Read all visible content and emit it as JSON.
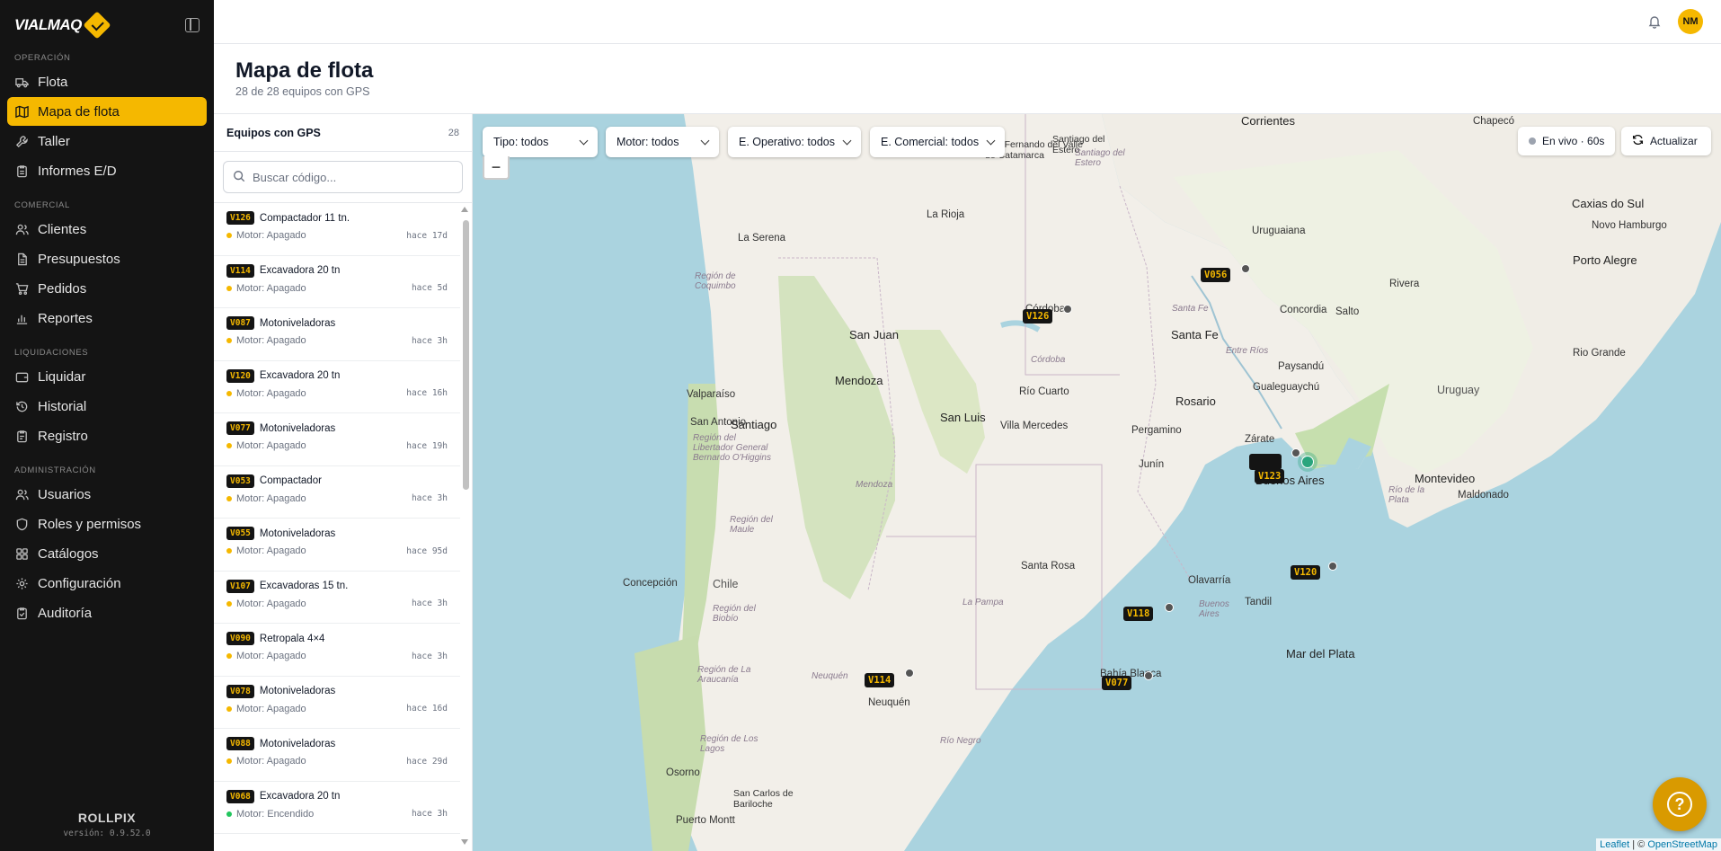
{
  "brand": {
    "name": "VIALMAQ"
  },
  "nav": {
    "sections": [
      {
        "title": "OPERACIÓN",
        "items": [
          "Flota",
          "Mapa de flota",
          "Taller",
          "Informes E/D"
        ]
      },
      {
        "title": "COMERCIAL",
        "items": [
          "Clientes",
          "Presupuestos",
          "Pedidos",
          "Reportes"
        ]
      },
      {
        "title": "LIQUIDACIONES",
        "items": [
          "Liquidar",
          "Historial",
          "Registro"
        ]
      },
      {
        "title": "ADMINISTRACIÓN",
        "items": [
          "Usuarios",
          "Roles y permisos",
          "Catálogos",
          "Configuración",
          "Auditoría"
        ]
      }
    ],
    "active": "Mapa de flota"
  },
  "footer": {
    "brand": "ROLLPIX",
    "version": "versión: 0.9.52.0"
  },
  "user": {
    "initials": "NM"
  },
  "page": {
    "title": "Mapa de flota",
    "subtitle": "28 de 28 equipos con GPS"
  },
  "list": {
    "title": "Equipos con GPS",
    "count": "28",
    "search_placeholder": "Buscar código...",
    "items": [
      {
        "code": "V126",
        "name": "Compactador 11 tn.",
        "status": "Motor: Apagado",
        "on": false,
        "ago": "hace 17d"
      },
      {
        "code": "V114",
        "name": "Excavadora 20 tn",
        "status": "Motor: Apagado",
        "on": false,
        "ago": "hace 5d"
      },
      {
        "code": "V087",
        "name": "Motoniveladoras",
        "status": "Motor: Apagado",
        "on": false,
        "ago": "hace 3h"
      },
      {
        "code": "V120",
        "name": "Excavadora 20 tn",
        "status": "Motor: Apagado",
        "on": false,
        "ago": "hace 16h"
      },
      {
        "code": "V077",
        "name": "Motoniveladoras",
        "status": "Motor: Apagado",
        "on": false,
        "ago": "hace 19h"
      },
      {
        "code": "V053",
        "name": "Compactador",
        "status": "Motor: Apagado",
        "on": false,
        "ago": "hace 3h"
      },
      {
        "code": "V055",
        "name": "Motoniveladoras",
        "status": "Motor: Apagado",
        "on": false,
        "ago": "hace 95d"
      },
      {
        "code": "V107",
        "name": "Excavadoras 15 tn.",
        "status": "Motor: Apagado",
        "on": false,
        "ago": "hace 3h"
      },
      {
        "code": "V090",
        "name": "Retropala 4×4",
        "status": "Motor: Apagado",
        "on": false,
        "ago": "hace 3h"
      },
      {
        "code": "V078",
        "name": "Motoniveladoras",
        "status": "Motor: Apagado",
        "on": false,
        "ago": "hace 16d"
      },
      {
        "code": "V088",
        "name": "Motoniveladoras",
        "status": "Motor: Apagado",
        "on": false,
        "ago": "hace 29d"
      },
      {
        "code": "V068",
        "name": "Excavadora 20 tn",
        "status": "Motor: Encendido",
        "on": true,
        "ago": "hace 3h"
      }
    ]
  },
  "filters": {
    "tipo": "Tipo: todos",
    "motor": "Motor: todos",
    "operativo": "E. Operativo: todos",
    "comercial": "E. Comercial: todos"
  },
  "zoom_out": "−",
  "live": "En vivo · 60s",
  "refresh": "Actualizar",
  "map": {
    "markers": [
      "V056",
      "V126",
      "V123",
      "V120",
      "V118",
      "V114",
      "V077"
    ],
    "places": [
      "Corrientes",
      "Chapecó",
      "Caxias do Sul",
      "Novo Hamburgo",
      "Porto Alegre",
      "Uruguaiana",
      "Rivera",
      "Concordia",
      "Salto",
      "Santa Fe",
      "Paysandú",
      "Rio Grande",
      "Uruguay",
      "Gualeguaychú",
      "Rosario",
      "Pergamino",
      "Zárate",
      "Junín",
      "Buenos Aires",
      "Montevideo",
      "Maldonado",
      "Olavarría",
      "Tandil",
      "Mar del Plata",
      "Santa Rosa",
      "Córdoba",
      "Río Cuarto",
      "Villa Mercedes",
      "San Luis",
      "Mendoza",
      "San Juan",
      "La Rioja",
      "La Serena",
      "Valparaíso",
      "Santiago",
      "San Antonio",
      "Concepción",
      "Chile",
      "Neuquén",
      "Bahía Blanca",
      "Osorno",
      "Puerto Montt",
      "San Carlos de Bariloche",
      "San Fernando del Valle de Catamarca",
      "Santiago del Estero"
    ],
    "regions": [
      "Región de Coquimbo",
      "Región del Libertador General Bernardo O'Higgins",
      "Región del Maule",
      "Región del Biobío",
      "Región de La Araucanía",
      "Región de Los Lagos",
      "Córdoba",
      "Mendoza",
      "La Pampa",
      "Río Negro",
      "Neuquén",
      "Buenos Aires",
      "Entre Ríos",
      "Santa Fe",
      "Santiago del Estero",
      "Río de la Plata"
    ]
  },
  "attribution": {
    "leaflet": "Leaflet",
    "sep": " | © ",
    "osm": "OpenStreetMap"
  }
}
